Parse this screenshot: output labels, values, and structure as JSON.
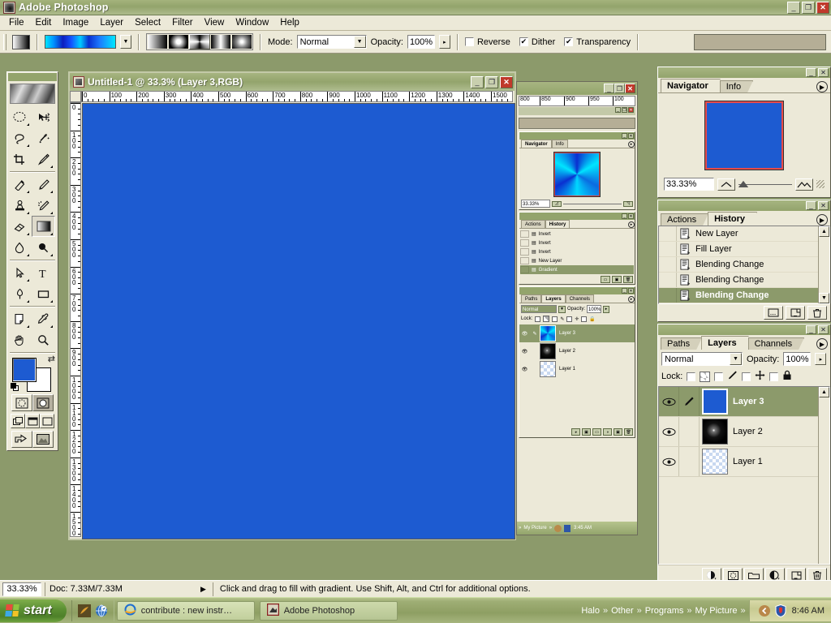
{
  "app": {
    "title": "Adobe Photoshop",
    "icon": "photoshop-icon",
    "window_buttons": {
      "minimize": "_",
      "restore": "❐",
      "close": "✕"
    }
  },
  "menubar": {
    "items": [
      "File",
      "Edit",
      "Image",
      "Layer",
      "Select",
      "Filter",
      "View",
      "Window",
      "Help"
    ]
  },
  "options_bar": {
    "tool_preset_label": "gradient-swatch",
    "gradient_preview": "blue-cyan-gradient",
    "gradient_types": [
      "linear-gradient",
      "radial-gradient",
      "angle-gradient",
      "reflected-gradient",
      "diamond-gradient"
    ],
    "gradient_type_selected": "angle-gradient",
    "mode_label": "Mode:",
    "mode_value": "Normal",
    "opacity_label": "Opacity:",
    "opacity_value": "100%",
    "reverse_label": "Reverse",
    "reverse_checked": false,
    "dither_label": "Dither",
    "dither_checked": true,
    "transparency_label": "Transparency",
    "transparency_checked": true
  },
  "toolbox": {
    "tools": [
      "marquee-tool",
      "move-tool",
      "lasso-tool",
      "magic-wand-tool",
      "crop-tool",
      "slice-tool",
      "healing-brush-tool",
      "brush-tool",
      "clone-stamp-tool",
      "history-brush-tool",
      "eraser-tool",
      "gradient-tool",
      "blur-tool",
      "dodge-tool",
      "path-selection-tool",
      "type-tool",
      "pen-tool",
      "shape-tool",
      "notes-tool",
      "eyedropper-tool",
      "hand-tool",
      "zoom-tool"
    ],
    "active_tool": "gradient-tool",
    "foreground_color": "#1d5bd1",
    "background_color": "#ffffff",
    "quickmask_modes": [
      "standard-mode",
      "quick-mask-mode"
    ],
    "screen_modes": [
      "standard-screen-mode",
      "full-screen-with-menubar",
      "full-screen-mode"
    ],
    "jump_to": [
      "jump-to-imageready",
      "jump-to-other"
    ]
  },
  "document": {
    "title": "Untitled-1 @ 33.3% (Layer 3,RGB)",
    "window_buttons": {
      "minimize": "_",
      "restore": "❐",
      "close": "✕"
    },
    "ruler_h_ticks": [
      "0",
      "100",
      "200",
      "300",
      "400",
      "500",
      "600",
      "700",
      "800",
      "900",
      "1000",
      "1100",
      "1200",
      "1300",
      "1400",
      "1500"
    ],
    "ruler_v_ticks": [
      "0",
      "100",
      "200",
      "300",
      "400",
      "500",
      "600",
      "700",
      "800",
      "900",
      "1000",
      "1100",
      "1200",
      "1300",
      "1400",
      "1500"
    ],
    "canvas_color": "#1d5bd1"
  },
  "background_window": {
    "title": "",
    "ruler_ticks": [
      "800",
      "850",
      "900",
      "950",
      "100"
    ],
    "navigator": {
      "tabs": [
        "Navigator",
        "Info"
      ],
      "selected_tab": "Navigator",
      "zoom_value": "33.33%",
      "thumbnail": "angle-gradient-thumb"
    },
    "history": {
      "tabs": [
        "Actions",
        "History"
      ],
      "selected_tab": "History",
      "items": [
        "Invert",
        "Invert",
        "Invert",
        "New Layer",
        "Gradient"
      ],
      "selected_item": "Gradient"
    },
    "layers": {
      "tabs": [
        "Paths",
        "Layers",
        "Channels"
      ],
      "selected_tab": "Layers",
      "blend_mode": "Normal",
      "opacity_label": "Opacity:",
      "opacity_value": "100%",
      "lock_label": "Lock:",
      "rows": [
        {
          "name": "Layer 3",
          "thumb": "angle-gradient-thumb",
          "visible": true,
          "selected": true
        },
        {
          "name": "Layer 2",
          "thumb": "smoke-thumb",
          "visible": true,
          "selected": false
        },
        {
          "name": "Layer 1",
          "thumb": "transparent-checker-thumb",
          "visible": true,
          "selected": false
        }
      ]
    },
    "taskbar_time": "3:45 AM",
    "taskbar_links": [
      "My Picture"
    ]
  },
  "navigator_palette": {
    "tabs": [
      "Navigator",
      "Info"
    ],
    "selected_tab": "Navigator",
    "zoom_value": "33.33%",
    "thumbnail_color": "#1d5bd1",
    "view_box_color": "#e64b4b",
    "menu_icon": "palette-menu-icon"
  },
  "history_palette": {
    "tabs": [
      "Actions",
      "History"
    ],
    "selected_tab": "History",
    "menu_icon": "palette-menu-icon",
    "items": [
      {
        "label": "New Layer",
        "selected": false
      },
      {
        "label": "Fill Layer",
        "selected": false
      },
      {
        "label": "Blending Change",
        "selected": false
      },
      {
        "label": "Blending Change",
        "selected": false
      },
      {
        "label": "Blending Change",
        "selected": true
      }
    ],
    "footer_buttons": [
      "create-document-from-state-icon",
      "create-new-snapshot-icon",
      "delete-state-icon"
    ]
  },
  "layers_palette": {
    "tabs": [
      "Paths",
      "Layers",
      "Channels"
    ],
    "selected_tab": "Layers",
    "menu_icon": "palette-menu-icon",
    "blend_mode": "Normal",
    "opacity_label": "Opacity:",
    "opacity_value": "100%",
    "lock_label": "Lock:",
    "lock_options": [
      "lock-transparent-pixels",
      "lock-image-pixels",
      "lock-position",
      "lock-all"
    ],
    "lock_checked": [
      false,
      false,
      false,
      false
    ],
    "rows": [
      {
        "name": "Layer 3",
        "thumb": "solid-blue-thumb",
        "visible": true,
        "linked": true,
        "selected": true
      },
      {
        "name": "Layer 2",
        "thumb": "smoke-thumb",
        "visible": true,
        "linked": false,
        "selected": false
      },
      {
        "name": "Layer 1",
        "thumb": "transparent-checker-thumb",
        "visible": true,
        "linked": false,
        "selected": false
      }
    ],
    "footer_buttons": [
      "layer-style-icon",
      "layer-mask-icon",
      "new-group-icon",
      "adjustment-layer-icon",
      "new-layer-icon",
      "delete-layer-icon"
    ]
  },
  "status_bar": {
    "zoom": "33.33%",
    "doc_size": "Doc: 7.33M/7.33M",
    "hint": "Click and drag to fill with gradient.  Use Shift, Alt, and Ctrl for additional options."
  },
  "taskbar": {
    "start_label": "start",
    "quick_launch": [
      "media-player-icon",
      "internet-icon"
    ],
    "tasks": [
      {
        "label": "contribute : new instr…",
        "icon": "internet-explorer-icon",
        "active": false
      },
      {
        "label": "Adobe Photoshop",
        "icon": "photoshop-icon",
        "active": true
      }
    ],
    "links": [
      "Halo",
      "Other",
      "Programs",
      "My Picture"
    ],
    "chevron": "»",
    "tray_icons": [
      "show-hidden-icons-icon",
      "antivirus-shield-icon"
    ],
    "clock": "8:46 AM"
  }
}
